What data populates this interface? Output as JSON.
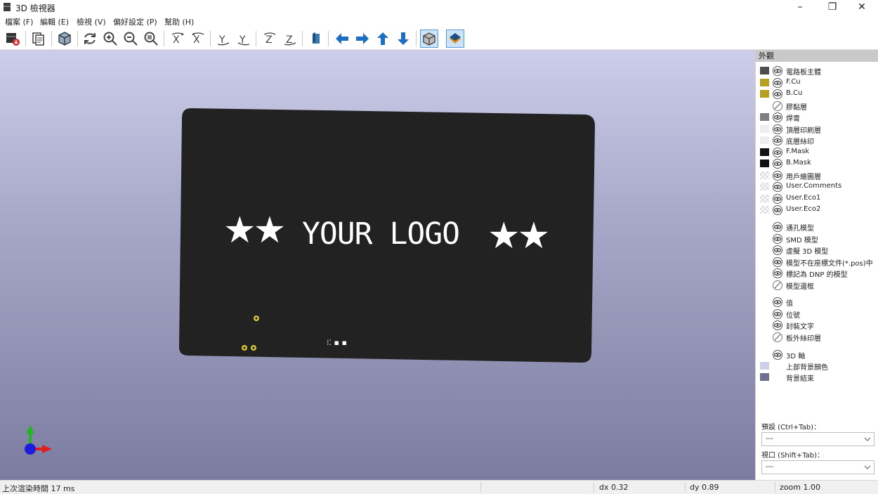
{
  "window": {
    "title": "3D 檢視器",
    "controls": {
      "minimize": "–",
      "restore": "❐",
      "close": "✕"
    }
  },
  "menu": [
    "檔案 (F)",
    "編輯 (E)",
    "檢視 (V)",
    "偏好設定 (P)",
    "幫助 (H)"
  ],
  "toolbar": {
    "icons": [
      "export-image-icon",
      "copy-clipboard-icon",
      "raytracing-cube-icon",
      "reload-icon",
      "zoom-in-icon",
      "zoom-out-icon",
      "zoom-fit-icon",
      "rotate-x-cw-icon",
      "rotate-x-ccw-icon",
      "rotate-y-cw-icon",
      "rotate-y-ccw-icon",
      "rotate-z-cw-icon",
      "rotate-z-ccw-icon",
      "flip-board-icon",
      "pan-left-icon",
      "pan-right-icon",
      "pan-up-icon",
      "pan-down-icon",
      "ortho-view-icon",
      "layers-toggle-icon"
    ]
  },
  "board": {
    "logo_text": "YOUR LOGO",
    "stars": "★★",
    "silk_marks": "⁝⁚ ▪ ▪"
  },
  "panel": {
    "header": "外觀",
    "layers": [
      {
        "label": "電路板主體",
        "color": "#4d4d4d",
        "visible": true
      },
      {
        "label": "F.Cu",
        "color": "#b5a01f",
        "visible": true
      },
      {
        "label": "B.Cu",
        "color": "#b5a01f",
        "visible": true
      },
      {
        "label": "膠黏層",
        "color": "",
        "visible": false
      },
      {
        "label": "焊膏",
        "color": "#7f7f7f",
        "visible": true
      },
      {
        "label": "頂層印刷層",
        "color": "#eeeeee",
        "visible": true
      },
      {
        "label": "底層絲印",
        "color": "#eeeeee",
        "visible": true
      },
      {
        "label": "F.Mask",
        "color": "#111111",
        "visible": true
      },
      {
        "label": "B.Mask",
        "color": "#111111",
        "visible": true
      },
      {
        "label": "用戶繪圖層",
        "color": "checker",
        "visible": true
      },
      {
        "label": "User.Comments",
        "color": "checker",
        "visible": true
      },
      {
        "label": "User.Eco1",
        "color": "checker",
        "visible": true
      },
      {
        "label": "User.Eco2",
        "color": "checker",
        "visible": true
      }
    ],
    "models": [
      {
        "label": "通孔模型",
        "visible": true
      },
      {
        "label": "SMD 模型",
        "visible": true
      },
      {
        "label": "虛擬 3D 模型",
        "visible": true
      },
      {
        "label": "模型不在座標文件(*.pos)中",
        "visible": true
      },
      {
        "label": "標記為 DNP 的模型",
        "visible": true
      },
      {
        "label": "模型邊框",
        "visible": false
      }
    ],
    "misc": [
      {
        "label": "值",
        "visible": true
      },
      {
        "label": "位號",
        "visible": true
      },
      {
        "label": "封裝文字",
        "visible": true
      },
      {
        "label": "板外絲印層",
        "visible": false
      }
    ],
    "axes": {
      "label": "3D 軸",
      "visible": true
    },
    "bg_top": {
      "label": "上部背景顏色",
      "color": "#cfcfe8"
    },
    "bg_bottom": {
      "label": "背景結束",
      "color": "#6f6f90"
    },
    "preset_label": "預設 (Ctrl+Tab)：",
    "preset_value": "---",
    "viewport_label": "視口 (Shift+Tab)：",
    "viewport_value": "---"
  },
  "status": {
    "render_time": "上次渲染時間 17 ms",
    "dx": "dx 0.32",
    "dy": "dy 0.89",
    "zoom": "zoom 1.00"
  }
}
